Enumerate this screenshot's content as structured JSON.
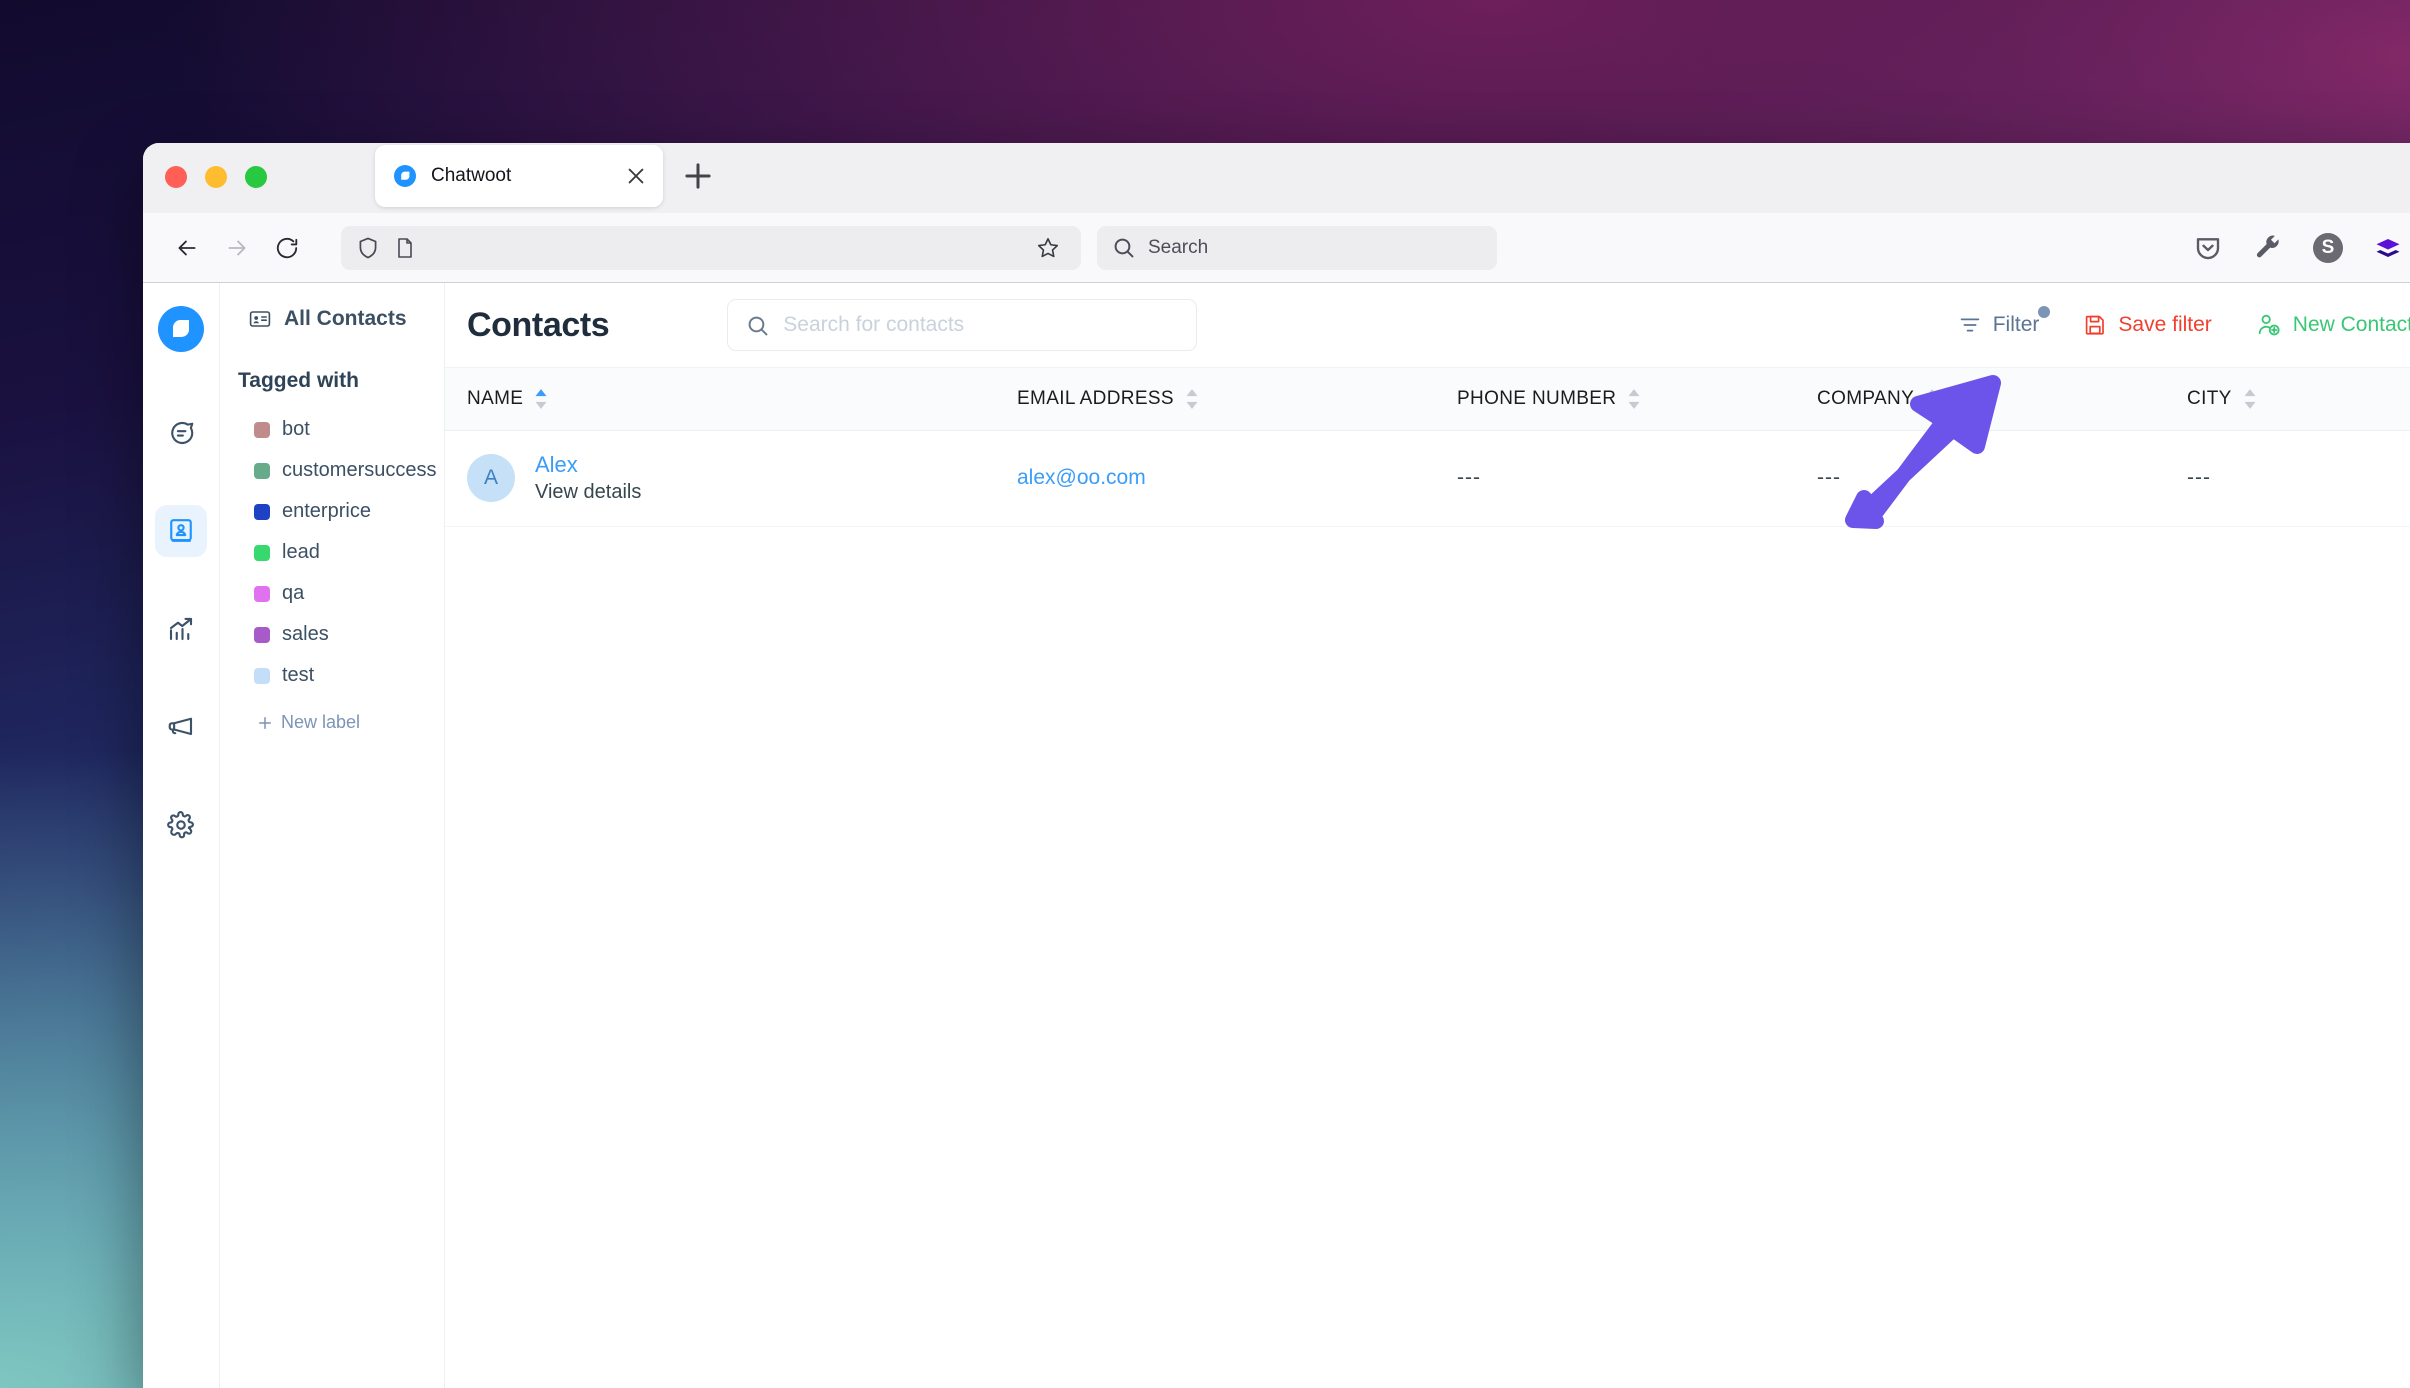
{
  "browser": {
    "traffic_lights": [
      "close",
      "minimize",
      "maximize"
    ],
    "tab": {
      "title": "Chatwoot",
      "favicon": "chatwoot-logo-icon",
      "close_icon": "close-icon"
    },
    "new_tab_icon": "plus-icon",
    "nav": {
      "back_icon": "arrow-left-icon",
      "forward_icon": "arrow-right-icon",
      "reload_icon": "reload-icon",
      "shield_icon": "shield-icon",
      "page_icon": "page-icon",
      "bookmark_icon": "star-icon",
      "url_value": ""
    },
    "search": {
      "placeholder": "Search",
      "icon": "search-icon"
    },
    "extensions": [
      {
        "name": "pocket-icon"
      },
      {
        "name": "wrench-icon"
      },
      {
        "name": "account-avatar",
        "letter": "S"
      },
      {
        "name": "layers-extension-icon"
      }
    ]
  },
  "app": {
    "rail": {
      "logo": "chatwoot-logo-icon",
      "items": [
        {
          "name": "conversations",
          "icon": "chat-bubble-icon",
          "active": false
        },
        {
          "name": "contacts",
          "icon": "contact-book-icon",
          "active": true
        },
        {
          "name": "reports",
          "icon": "chart-trend-icon",
          "active": false
        },
        {
          "name": "campaigns",
          "icon": "megaphone-icon",
          "active": false
        },
        {
          "name": "settings",
          "icon": "gear-icon",
          "active": false
        }
      ]
    },
    "sidebar": {
      "all_contacts": {
        "label": "All Contacts",
        "icon": "contact-card-icon"
      },
      "tagged_with_title": "Tagged with",
      "labels": [
        {
          "name": "bot",
          "color": "#c08b8b"
        },
        {
          "name": "customersuccess",
          "color": "#68ab8b"
        },
        {
          "name": "enterprice",
          "color": "#1f41c4"
        },
        {
          "name": "lead",
          "color": "#37d96f"
        },
        {
          "name": "qa",
          "color": "#e072f0"
        },
        {
          "name": "sales",
          "color": "#a75bc9"
        },
        {
          "name": "test",
          "color": "#c4ddf8"
        }
      ],
      "new_label": "New label",
      "new_label_icon": "plus-icon"
    },
    "header": {
      "title": "Contacts",
      "search_placeholder": "Search for contacts",
      "search_icon": "search-icon",
      "actions": [
        {
          "key": "filter",
          "label": "Filter",
          "icon": "filter-icon",
          "color": "#5b7493",
          "has_badge": true
        },
        {
          "key": "save_filter",
          "label": "Save filter",
          "icon": "save-disk-icon",
          "color": "#f0402f",
          "has_badge": false
        },
        {
          "key": "new_contact",
          "label": "New Contact",
          "icon": "user-plus-icon",
          "color": "#3ac775",
          "has_badge": false
        }
      ]
    },
    "table": {
      "columns": [
        {
          "key": "name",
          "label": "NAME",
          "sort": "asc"
        },
        {
          "key": "email",
          "label": "EMAIL ADDRESS",
          "sort": "none"
        },
        {
          "key": "phone",
          "label": "PHONE NUMBER",
          "sort": "none"
        },
        {
          "key": "company",
          "label": "COMPANY",
          "sort": "none"
        },
        {
          "key": "city",
          "label": "CITY",
          "sort": "none"
        }
      ],
      "rows": [
        {
          "avatar_letter": "A",
          "name": "Alex",
          "view_details": "View details",
          "email": "alex@oo.com",
          "phone": "---",
          "company": "---",
          "city": "---"
        }
      ]
    }
  },
  "annotation": {
    "arrow_color": "#6c53ea",
    "points_to": "Save filter"
  }
}
